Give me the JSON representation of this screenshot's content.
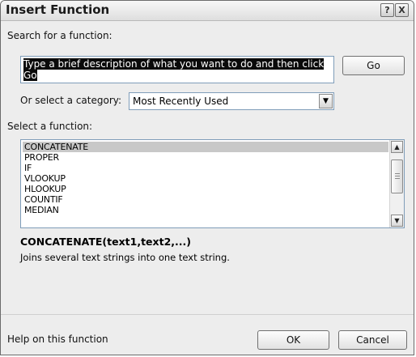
{
  "dialog": {
    "title": "Insert Function",
    "help_button": "?",
    "close_button": "X"
  },
  "search": {
    "label": "Search for a function:",
    "value": "Type a brief description of what you want to do and then click Go",
    "go_button": "Go"
  },
  "category": {
    "label": "Or select a category:",
    "selected": "Most Recently Used"
  },
  "functions": {
    "label": "Select a function:",
    "items": [
      "CONCATENATE",
      "PROPER",
      "IF",
      "VLOOKUP",
      "HLOOKUP",
      "COUNTIF",
      "MEDIAN"
    ],
    "selected_index": 0
  },
  "selected_function": {
    "signature": "CONCATENATE(text1,text2,...)",
    "description": "Joins several text strings into one text string."
  },
  "footer": {
    "help_link": "Help on this function",
    "ok_button": "OK",
    "cancel_button": "Cancel"
  },
  "icons": {
    "combo_arrow": "chevron-down-icon",
    "scroll_up": "arrow-up-icon",
    "scroll_down": "arrow-down-icon"
  }
}
